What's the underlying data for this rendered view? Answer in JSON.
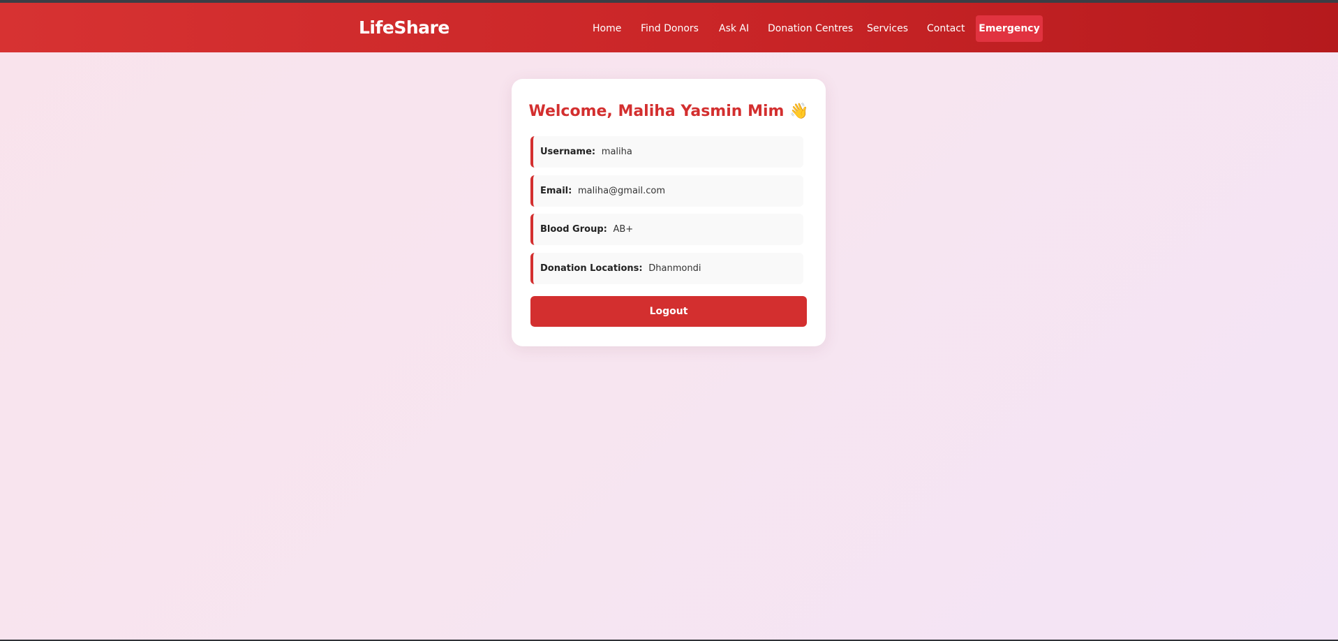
{
  "navbar": {
    "brand": "LifeShare",
    "items": [
      {
        "label": "Home"
      },
      {
        "label": "Find Donors"
      },
      {
        "label": "Ask AI"
      },
      {
        "label": "Donation Centres"
      },
      {
        "label": "Services"
      },
      {
        "label": "Contact"
      }
    ],
    "emergency_label": "Emergency"
  },
  "profile": {
    "welcome": "Welcome, Maliha Yasmin Mim",
    "wave_emoji": "👋",
    "fields": [
      {
        "label": "Username:",
        "value": "maliha"
      },
      {
        "label": "Email:",
        "value": "maliha@gmail.com"
      },
      {
        "label": "Blood Group:",
        "value": "AB+"
      },
      {
        "label": "Donation Locations:",
        "value": "Dhanmondi"
      }
    ],
    "logout_label": "Logout"
  },
  "colors": {
    "primary_red": "#d32f2f",
    "navbar_start": "#d73232",
    "navbar_end": "#b51a1d",
    "emergency_bg": "#e13340",
    "background": "#f9e3ec",
    "card_bg": "#ffffff",
    "row_bg": "#f9f9f9"
  }
}
